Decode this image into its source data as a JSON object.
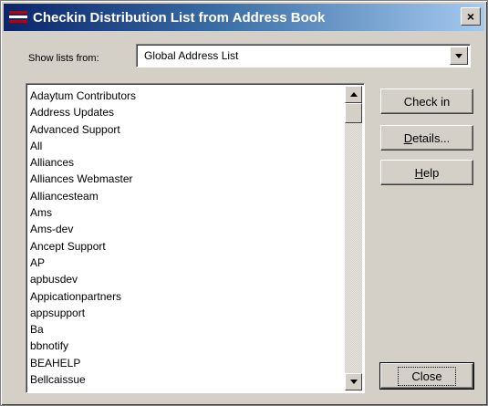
{
  "window": {
    "title": "Checkin Distribution List from Address Book",
    "close_glyph": "×"
  },
  "show_lists": {
    "label": "Show lists from:",
    "selected": "Global Address List"
  },
  "list": {
    "items": [
      "Adaytum Contributors",
      "Address Updates",
      "Advanced Support",
      "All",
      "Alliances",
      "Alliances Webmaster",
      "Alliancesteam",
      "Ams",
      "Ams-dev",
      "Ancept Support",
      "AP",
      "apbusdev",
      "Appicationpartners",
      "appsupport",
      "Ba",
      "bbnotify",
      "BEAHELP",
      "Bellcaissue"
    ]
  },
  "buttons": {
    "checkin": "Check in",
    "details_mnemonic": "D",
    "details_rest": "etails...",
    "help_mnemonic": "H",
    "help_rest": "elp",
    "close": "Close"
  },
  "icons": {
    "app": "address-book-icon",
    "combo_arrow": "chevron-down-icon",
    "scroll_up": "arrow-up-icon",
    "scroll_down": "arrow-down-icon"
  }
}
